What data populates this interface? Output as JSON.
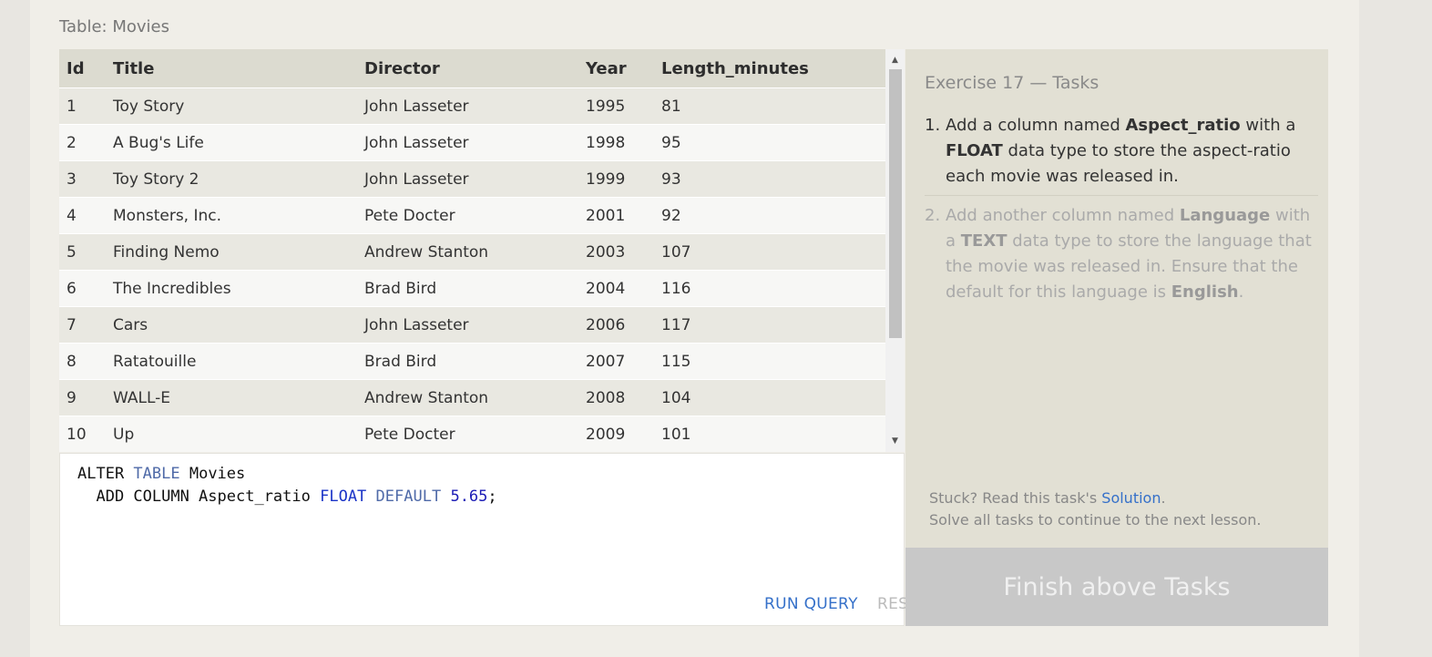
{
  "table_caption": "Table: Movies",
  "table": {
    "columns": [
      "Id",
      "Title",
      "Director",
      "Year",
      "Length_minutes"
    ],
    "rows": [
      [
        "1",
        "Toy Story",
        "John Lasseter",
        "1995",
        "81"
      ],
      [
        "2",
        "A Bug's Life",
        "John Lasseter",
        "1998",
        "95"
      ],
      [
        "3",
        "Toy Story 2",
        "John Lasseter",
        "1999",
        "93"
      ],
      [
        "4",
        "Monsters, Inc.",
        "Pete Docter",
        "2001",
        "92"
      ],
      [
        "5",
        "Finding Nemo",
        "Andrew Stanton",
        "2003",
        "107"
      ],
      [
        "6",
        "The Incredibles",
        "Brad Bird",
        "2004",
        "116"
      ],
      [
        "7",
        "Cars",
        "John Lasseter",
        "2006",
        "117"
      ],
      [
        "8",
        "Ratatouille",
        "Brad Bird",
        "2007",
        "115"
      ],
      [
        "9",
        "WALL-E",
        "Andrew Stanton",
        "2008",
        "104"
      ],
      [
        "10",
        "Up",
        "Pete Docter",
        "2009",
        "101"
      ]
    ]
  },
  "editor": {
    "code": {
      "line1": [
        "ALTER ",
        "TABLE",
        " Movies"
      ],
      "line2": [
        "  ADD COLUMN Aspect_ratio ",
        "FLOAT",
        " ",
        "DEFAULT",
        " ",
        "5.65",
        ";"
      ]
    },
    "run_label": "RUN QUERY",
    "reset_label": "RESET"
  },
  "tasks": {
    "title": "Exercise 17 — Tasks",
    "task1": {
      "number": "1.",
      "parts": [
        "Add a column named ",
        "Aspect_ratio",
        " with a ",
        "FLOAT",
        " data type to store the aspect-ratio each movie was released in."
      ]
    },
    "task2": {
      "number": "2.",
      "parts": [
        "Add another column named ",
        "Language",
        " with a ",
        "TEXT",
        " data type to store the language that the movie was released in. Ensure that the default for this language is ",
        "English",
        "."
      ]
    },
    "stuck_prefix": "Stuck? Read this task's ",
    "solution_label": "Solution",
    "stuck_suffix": ".",
    "continue_text": "Solve all tasks to continue to the next lesson.",
    "finish_label": "Finish above Tasks"
  },
  "scrollbar": {
    "up_icon": "▲",
    "down_icon": "▼"
  },
  "colors": {
    "keyword": "#1a33c7",
    "link": "#3570c9",
    "header_bg": "#dcdbd0",
    "finish_bg": "#c8c8c8"
  }
}
